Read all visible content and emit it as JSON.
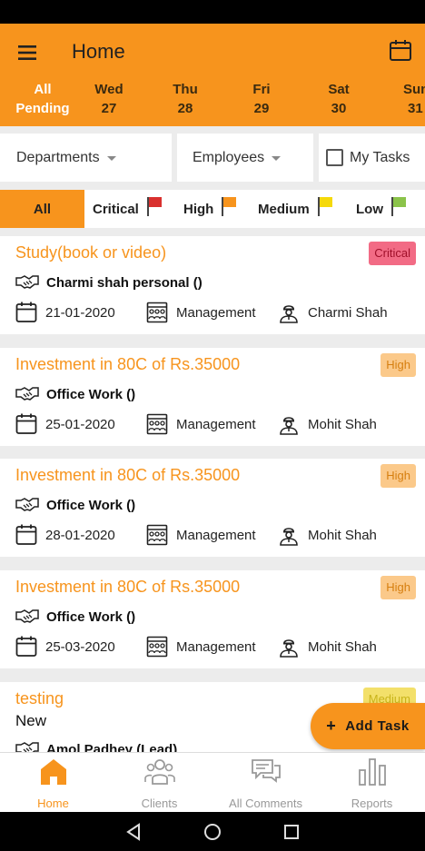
{
  "header": {
    "title": "Home"
  },
  "days": [
    {
      "name": "All",
      "num": "Pending"
    },
    {
      "name": "Wed",
      "num": "27"
    },
    {
      "name": "Thu",
      "num": "28"
    },
    {
      "name": "Fri",
      "num": "29"
    },
    {
      "name": "Sat",
      "num": "30"
    },
    {
      "name": "Sun",
      "num": "31"
    }
  ],
  "filters": {
    "departments": "Departments",
    "employees": "Employees",
    "my_tasks": "My Tasks"
  },
  "priority_tabs": [
    {
      "label": "All",
      "flag_color": ""
    },
    {
      "label": "Critical",
      "flag_color": "#d9302e"
    },
    {
      "label": "High",
      "flag_color": "#f7941d"
    },
    {
      "label": "Medium",
      "flag_color": "#f5d90a"
    },
    {
      "label": "Low",
      "flag_color": "#8bc34a"
    }
  ],
  "tasks": [
    {
      "title": "Study(book or video)",
      "priority": "Critical",
      "client": "Charmi shah personal ()",
      "date": "21-01-2020",
      "department": "Management",
      "employee": "Charmi Shah"
    },
    {
      "title": "Investment in 80C of Rs.35000",
      "priority": "High",
      "client": "Office Work ()",
      "date": "25-01-2020",
      "department": "Management",
      "employee": "Mohit Shah"
    },
    {
      "title": "Investment in 80C of Rs.35000",
      "priority": "High",
      "client": "Office Work ()",
      "date": "28-01-2020",
      "department": "Management",
      "employee": "Mohit Shah"
    },
    {
      "title": "Investment in 80C of Rs.35000",
      "priority": "High",
      "client": "Office Work ()",
      "date": "25-03-2020",
      "department": "Management",
      "employee": "Mohit Shah"
    },
    {
      "title": "testing",
      "subtitle": "New",
      "priority": "Medium",
      "client": "Amol Padhey (Lead)"
    }
  ],
  "fab": {
    "plus": "+",
    "label": "Add Task"
  },
  "bottom_nav": [
    {
      "label": "Home"
    },
    {
      "label": "Clients"
    },
    {
      "label": "All Comments"
    },
    {
      "label": "Reports"
    }
  ],
  "colors": {
    "accent": "#f7941d"
  }
}
